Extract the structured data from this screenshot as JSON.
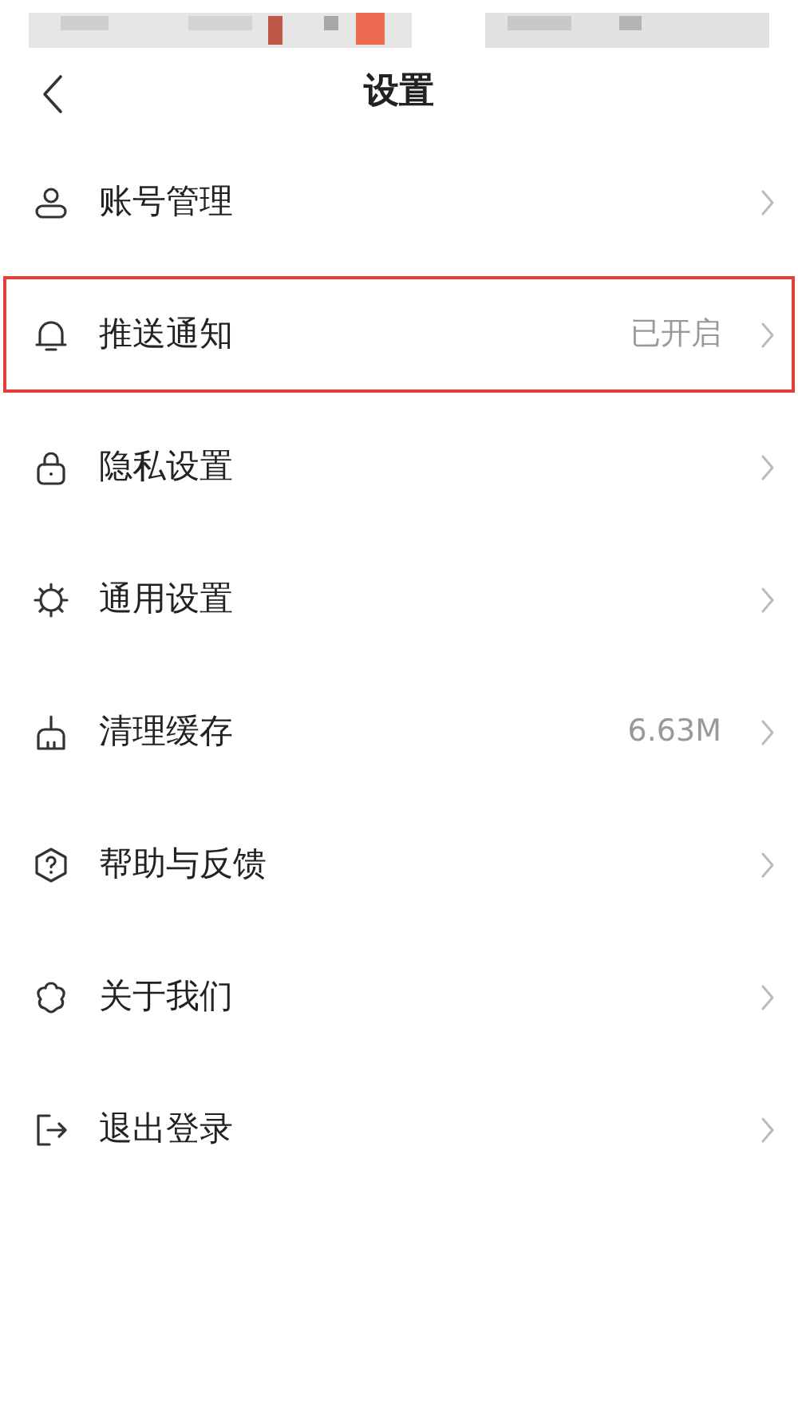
{
  "header": {
    "title": "设置"
  },
  "items": [
    {
      "label": "账号管理",
      "highlighted": false
    },
    {
      "label": "推送通知",
      "value": "已开启",
      "highlighted": true
    },
    {
      "label": "隐私设置",
      "highlighted": false
    },
    {
      "label": "通用设置",
      "highlighted": false
    },
    {
      "label": "清理缓存",
      "value": "6.63M",
      "highlighted": false
    },
    {
      "label": "帮助与反馈",
      "highlighted": false
    },
    {
      "label": "关于我们",
      "highlighted": false
    },
    {
      "label": "退出登录",
      "highlighted": false
    }
  ]
}
